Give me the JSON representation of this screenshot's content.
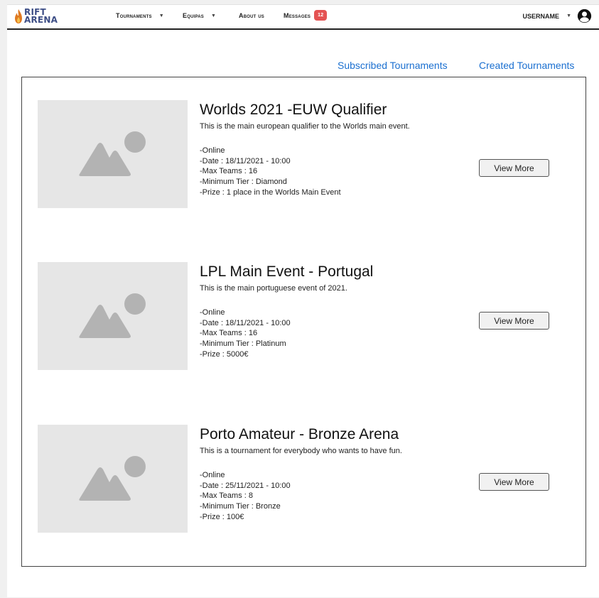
{
  "app": {
    "logo_line1": "RIFT",
    "logo_line2": "ARENA"
  },
  "nav": {
    "tournaments": "Tournaments",
    "teams": "Equipas",
    "about": "About us",
    "messages": "Messages",
    "messages_badge": "12",
    "username": "USERNAME"
  },
  "tabs": {
    "subscribed": "Subscribed Tournaments",
    "created": "Created Tournaments"
  },
  "tournaments": [
    {
      "title": "Worlds 2021 -EUW Qualifier",
      "description": "This is the main european qualifier to the Worlds main event.",
      "location": "-Online",
      "date": "-Date : 18/11/2021 - 10:00",
      "max_teams": "-Max Teams : 16",
      "min_tier": "-Minimum Tier : Diamond",
      "prize": "-Prize : 1 place in the Worlds Main Event",
      "button": "View More"
    },
    {
      "title": "LPL Main Event - Portugal",
      "description": "This is the main portuguese event of 2021.",
      "location": "-Online",
      "date": "-Date : 18/11/2021 - 10:00",
      "max_teams": "-Max Teams : 16",
      "min_tier": "-Minimum Tier : Platinum",
      "prize": "-Prize : 5000€",
      "button": "View More"
    },
    {
      "title": "Porto Amateur - Bronze Arena",
      "description": "This is a tournament for everybody who wants to have fun.",
      "location": "-Online",
      "date": "-Date : 25/11/2021 - 10:00",
      "max_teams": "-Max Teams : 8",
      "min_tier": "-Minimum Tier : Bronze",
      "prize": "-Prize : 100€",
      "button": "View More"
    }
  ],
  "colors": {
    "link": "#1a6fd0",
    "badge": "#e45353",
    "logo": "#3d4e86",
    "placeholder": "#e6e6e6",
    "placeholder_icon": "#b3b3b3"
  }
}
